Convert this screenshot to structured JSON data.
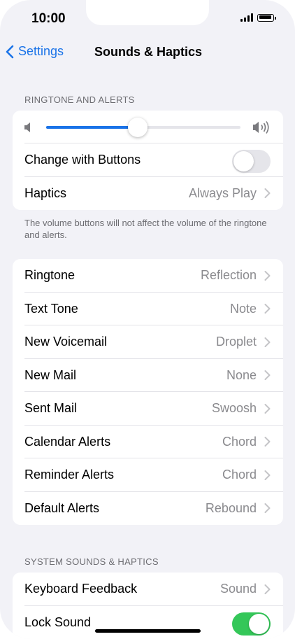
{
  "status_bar": {
    "time": "10:00"
  },
  "nav": {
    "back_label": "Settings",
    "title": "Sounds & Haptics"
  },
  "ringtone_section": {
    "header": "RINGTONE AND ALERTS",
    "volume_level": 0.47,
    "change_with_buttons": {
      "label": "Change with Buttons",
      "on": false
    },
    "haptics": {
      "label": "Haptics",
      "value": "Always Play"
    },
    "footnote": "The volume buttons will not affect the volume of the ringtone and alerts."
  },
  "sounds_list": [
    {
      "label": "Ringtone",
      "value": "Reflection"
    },
    {
      "label": "Text Tone",
      "value": "Note"
    },
    {
      "label": "New Voicemail",
      "value": "Droplet"
    },
    {
      "label": "New Mail",
      "value": "None"
    },
    {
      "label": "Sent Mail",
      "value": "Swoosh"
    },
    {
      "label": "Calendar Alerts",
      "value": "Chord"
    },
    {
      "label": "Reminder Alerts",
      "value": "Chord"
    },
    {
      "label": "Default Alerts",
      "value": "Rebound"
    }
  ],
  "system_section": {
    "header": "SYSTEM SOUNDS & HAPTICS",
    "keyboard_feedback": {
      "label": "Keyboard Feedback",
      "value": "Sound"
    },
    "lock_sound": {
      "label": "Lock Sound",
      "on": true
    }
  },
  "colors": {
    "accent": "#1a73e8",
    "toggle_on": "#34c759",
    "background": "#f2f2f7"
  }
}
